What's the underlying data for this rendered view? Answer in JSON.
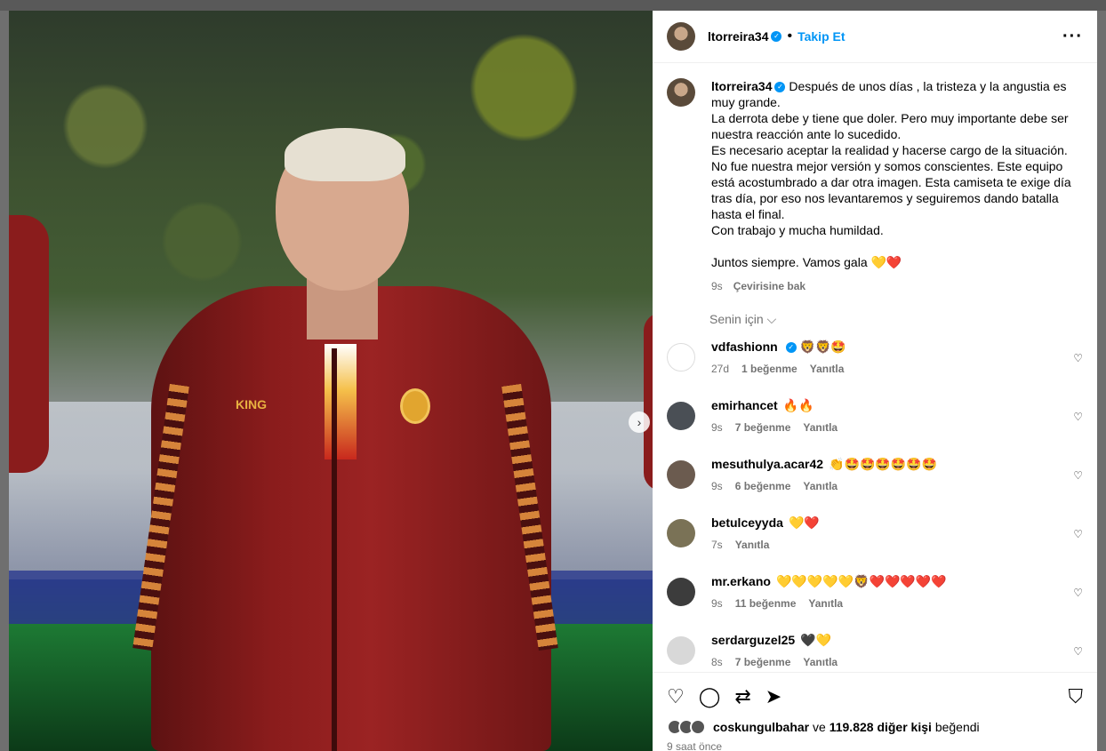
{
  "post_owner": {
    "username": "ltorreira34",
    "follow_label": "Takip Et",
    "separator": "•"
  },
  "caption": {
    "username": "ltorreira34",
    "lines": [
      "Después de unos días , la tristeza y la angustia es muy grande.",
      "La derrota debe y tiene que doler. Pero muy importante debe ser nuestra reacción ante lo sucedido.",
      "Es necesario aceptar la realidad y hacerse cargo de la situación.",
      "No fue nuestra mejor versión y somos conscientes. Este equipo está acostumbrado a dar otra imagen. Esta camiseta te exige día tras día, por eso nos levantaremos y seguiremos dando batalla hasta el final.",
      "Con trabajo y mucha humildad."
    ],
    "closing": "Juntos siempre. Vamos gala 💛❤️",
    "time": "9s",
    "translate_label": "Çevirisine bak"
  },
  "filter": {
    "label": "Senin için",
    "chevron": "⌵"
  },
  "comments": [
    {
      "username": "vdfashionn",
      "verified": true,
      "text": "🦁🦁🤩",
      "time": "27d",
      "likes": "1 beğenme",
      "reply": "Yanıtla"
    },
    {
      "username": "emirhancet",
      "verified": false,
      "text": "🔥🔥",
      "time": "9s",
      "likes": "7 beğenme",
      "reply": "Yanıtla"
    },
    {
      "username": "mesuthulya.acar42",
      "verified": false,
      "text": "👏🤩🤩🤩🤩🤩🤩",
      "time": "9s",
      "likes": "6 beğenme",
      "reply": "Yanıtla"
    },
    {
      "username": "betulceyyda",
      "verified": false,
      "text": "💛❤️",
      "time": "7s",
      "likes": "",
      "reply": "Yanıtla"
    },
    {
      "username": "mr.erkano",
      "verified": false,
      "text": "💛💛💛💛💛🦁❤️❤️❤️❤️❤️",
      "time": "9s",
      "likes": "11 beğenme",
      "reply": "Yanıtla"
    },
    {
      "username": "serdarguzel25",
      "verified": false,
      "text": "🖤💛",
      "time": "8s",
      "likes": "7 beğenme",
      "reply": "Yanıtla"
    }
  ],
  "likes": {
    "user": "coskungulbahar",
    "middle": "ve",
    "count": "119.828 diğer kişi",
    "suffix": "beğendi"
  },
  "time_ago": "9 saat önce",
  "icons": {
    "like": "heart-icon",
    "comment": "comment-icon",
    "repost": "repost-icon",
    "share": "share-icon",
    "save": "bookmark-icon",
    "more": "more-icon",
    "next": "chevron-right-icon",
    "verified": "verified-icon"
  },
  "colors": {
    "accent": "#0095f6",
    "muted": "#737373"
  }
}
